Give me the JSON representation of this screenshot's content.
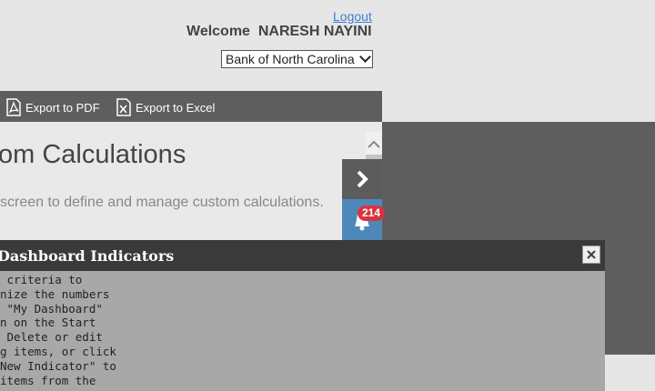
{
  "header": {
    "logout_label": "Logout",
    "welcome_text": "Welcome  NARESH NAYINI",
    "bank_select_value": "Bank of North Carolina"
  },
  "toolbar": {
    "export_pdf_label": "Export to PDF",
    "export_excel_label": "Export to Excel"
  },
  "content": {
    "title": "om Calculations",
    "description": "screen to define and manage custom calculations."
  },
  "side_panel": {
    "notification_count": "214"
  },
  "dialog": {
    "title": "Dashboard Indicators",
    "body_lines": [
      " criteria to",
      "nize the numbers",
      " \"My Dashboard\"",
      "n on the Start",
      " Delete or edit",
      "g items, or click",
      "New Indicator\" to",
      "items from the"
    ]
  },
  "colors": {
    "toolbar_bg": "#5e5e5e",
    "notification_bg": "#4e88b8",
    "badge_bg": "#d9333f",
    "dialog_header_bg": "#3a3a3a",
    "dialog_body_bg": "#a8a8a8",
    "link": "#3f7fcf"
  }
}
